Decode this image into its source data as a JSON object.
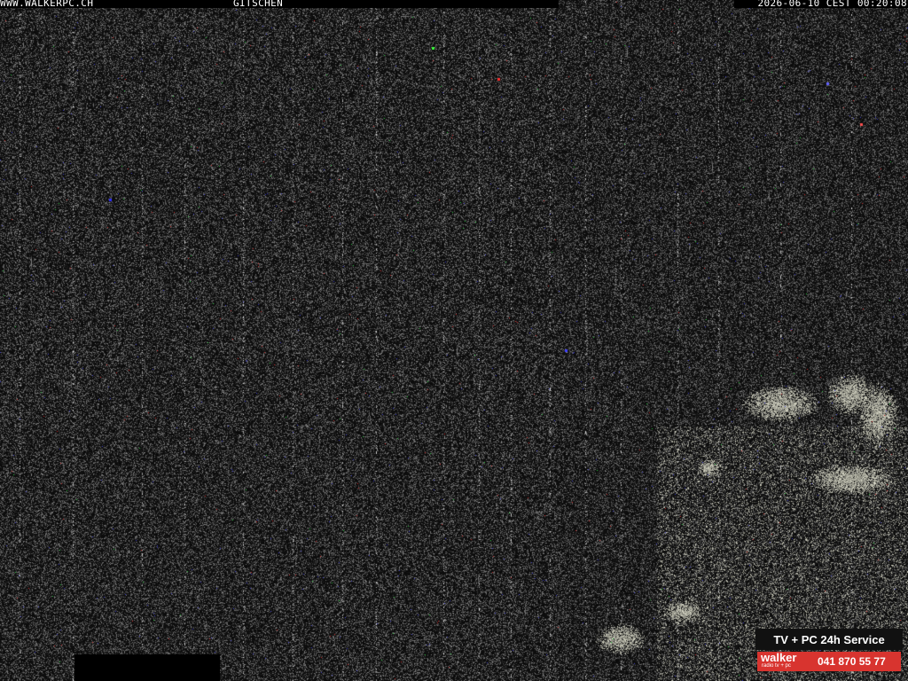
{
  "overlay": {
    "left_text": "WWW.WALKERPC.CH",
    "center_text": "GITSCHEN",
    "right_text": "2026-06-10 CEST 00:20:08"
  },
  "ad_banner": {
    "slogan": "TV + PC 24h Service",
    "brand": "walker",
    "tagline": "radio tv + pc",
    "phone": "041 870 55 77",
    "brand_color": "#d8342f"
  },
  "scene": {
    "description_icon": "night-webcam-noise",
    "foliage_color": "#b8b8a8"
  }
}
